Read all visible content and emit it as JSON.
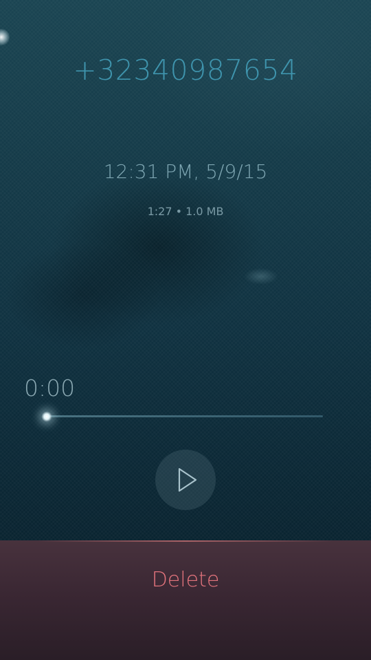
{
  "recording": {
    "phone_number": "+32340987654",
    "date_time": "12:31 PM, 5/9/15",
    "details": "1:27 • 1.0 MB"
  },
  "player": {
    "elapsed": "0:00",
    "progress": 0,
    "play_icon": "play-icon"
  },
  "actions": {
    "delete_label": "Delete"
  },
  "colors": {
    "accent": "#3f94ad",
    "delete": "#e4747d"
  }
}
